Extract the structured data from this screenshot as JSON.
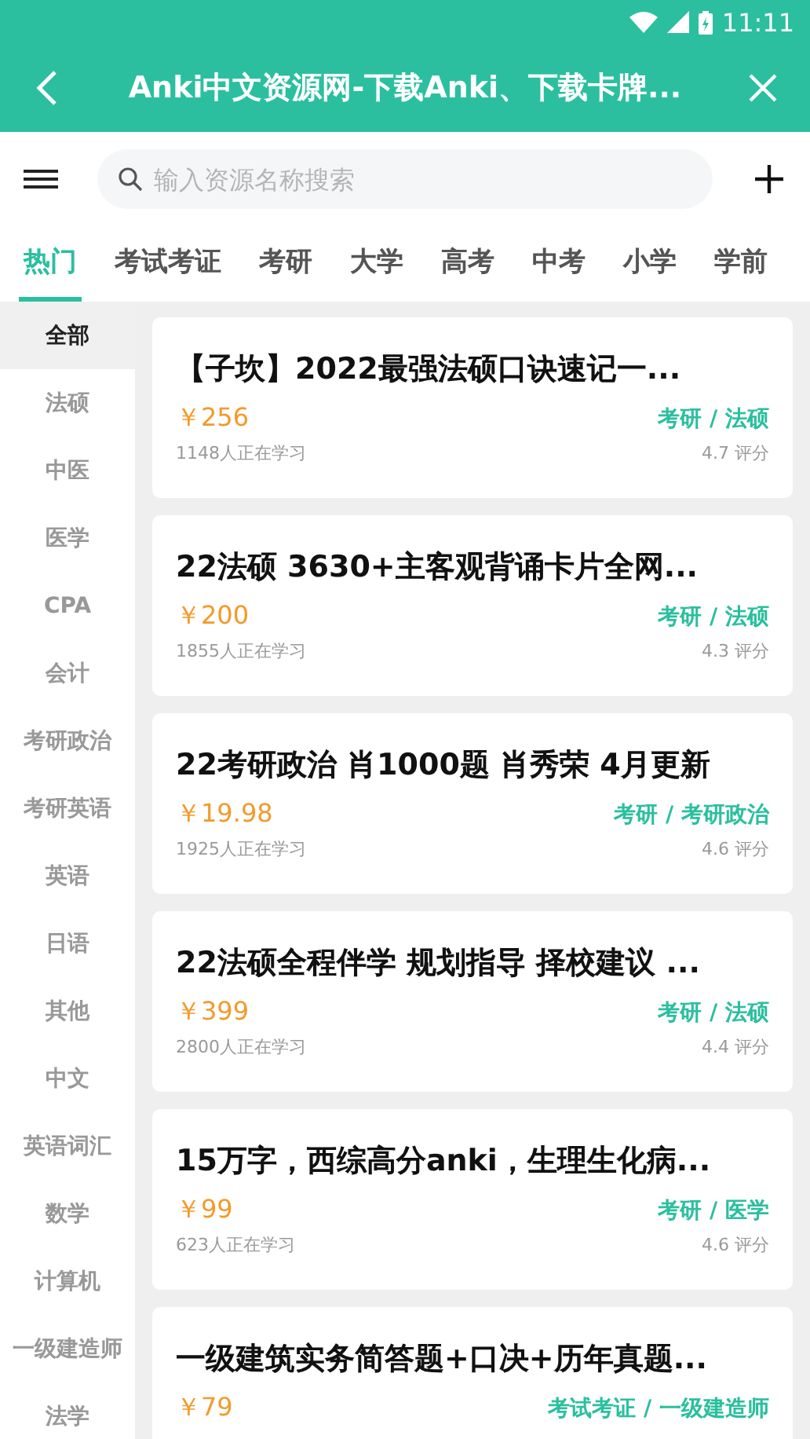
{
  "status_bar": {
    "time": "11:11"
  },
  "app_bar": {
    "title": "Anki中文资源网-下载Anki、下载卡牌..."
  },
  "search": {
    "placeholder": "输入资源名称搜索"
  },
  "tabs": [
    {
      "label": "热门",
      "selected": true
    },
    {
      "label": "考试考证",
      "selected": false
    },
    {
      "label": "考研",
      "selected": false
    },
    {
      "label": "大学",
      "selected": false
    },
    {
      "label": "高考",
      "selected": false
    },
    {
      "label": "中考",
      "selected": false
    },
    {
      "label": "小学",
      "selected": false
    },
    {
      "label": "学前",
      "selected": false
    }
  ],
  "sidebar": {
    "items": [
      {
        "label": "全部",
        "selected": true
      },
      {
        "label": "法硕",
        "selected": false
      },
      {
        "label": "中医",
        "selected": false
      },
      {
        "label": "医学",
        "selected": false
      },
      {
        "label": "CPA",
        "selected": false
      },
      {
        "label": "会计",
        "selected": false
      },
      {
        "label": "考研政治",
        "selected": false
      },
      {
        "label": "考研英语",
        "selected": false
      },
      {
        "label": "英语",
        "selected": false
      },
      {
        "label": "日语",
        "selected": false
      },
      {
        "label": "其他",
        "selected": false
      },
      {
        "label": "中文",
        "selected": false
      },
      {
        "label": "英语词汇",
        "selected": false
      },
      {
        "label": "数学",
        "selected": false
      },
      {
        "label": "计算机",
        "selected": false
      },
      {
        "label": "一级建造师",
        "selected": false
      },
      {
        "label": "法学",
        "selected": false
      }
    ]
  },
  "courses": [
    {
      "title": "【子坎】2022最强法硕口诀速记一...",
      "price": "￥256",
      "category": "考研 / 法硕",
      "learners": "1148人正在学习",
      "rating": "4.7 评分"
    },
    {
      "title": "22法硕 3630+主客观背诵卡片全网...",
      "price": "￥200",
      "category": "考研 / 法硕",
      "learners": "1855人正在学习",
      "rating": "4.3 评分"
    },
    {
      "title": "22考研政治 肖1000题 肖秀荣 4月更新",
      "price": "￥19.98",
      "category": "考研 / 考研政治",
      "learners": "1925人正在学习",
      "rating": "4.6 评分"
    },
    {
      "title": "22法硕全程伴学 规划指导 择校建议 ...",
      "price": "￥399",
      "category": "考研 / 法硕",
      "learners": "2800人正在学习",
      "rating": "4.4 评分"
    },
    {
      "title": "15万字，西综高分anki，生理生化病...",
      "price": "￥99",
      "category": "考研 / 医学",
      "learners": "623人正在学习",
      "rating": "4.6 评分"
    },
    {
      "title": "一级建筑实务简答题+口决+历年真题...",
      "price": "￥79",
      "category": "考试考证 / 一级建造师"
    }
  ]
}
